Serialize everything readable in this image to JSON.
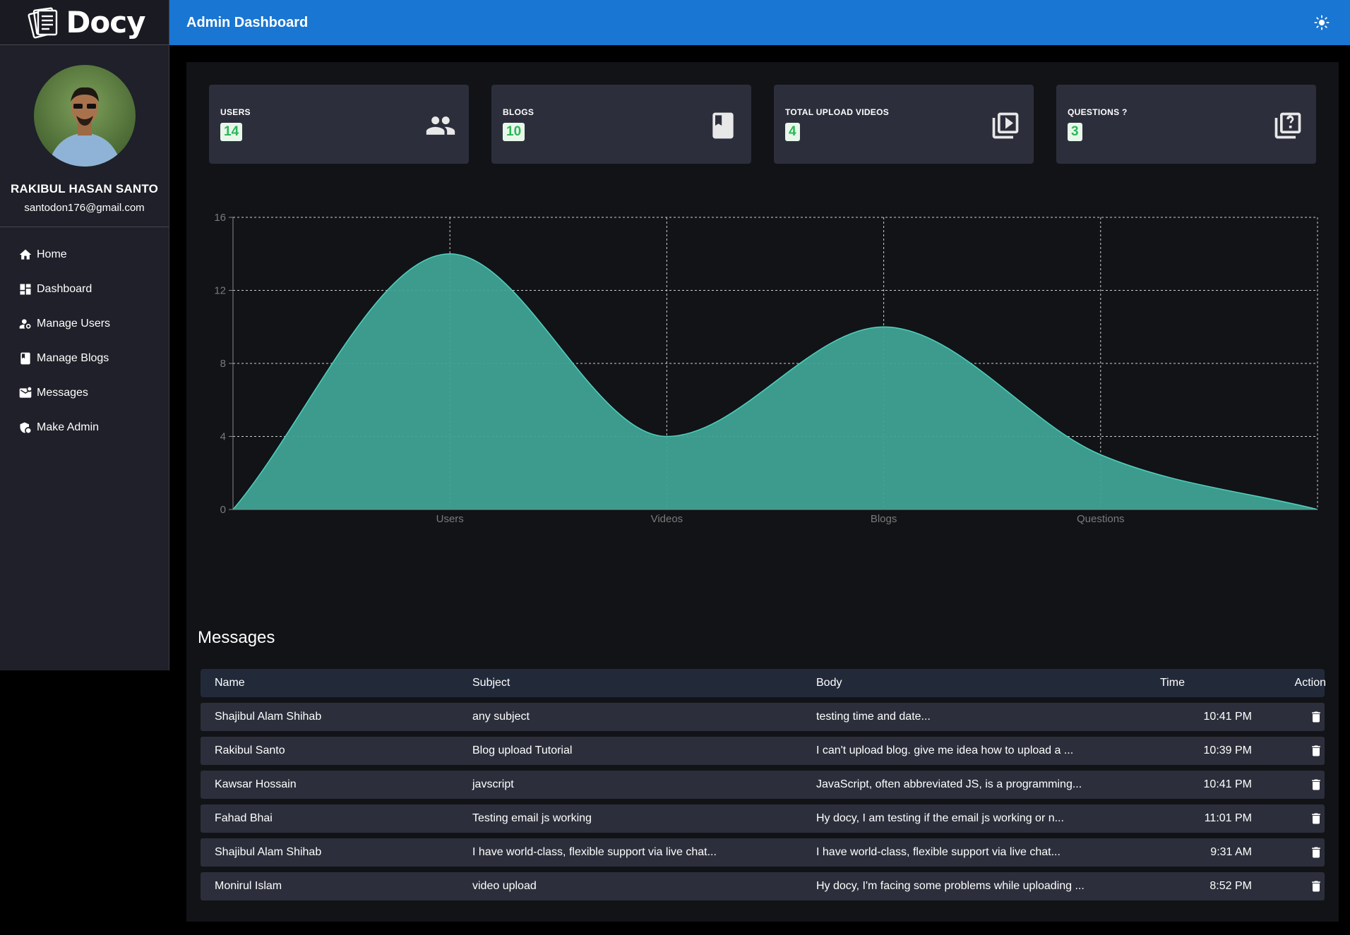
{
  "brand": {
    "name": "Docy"
  },
  "header": {
    "title": "Admin Dashboard"
  },
  "profile": {
    "name": "RAKIBUL HASAN SANTO",
    "email": "santodon176@gmail.com"
  },
  "sidebar": {
    "items": [
      {
        "label": "Home",
        "icon": "home-icon"
      },
      {
        "label": "Dashboard",
        "icon": "dashboard-icon"
      },
      {
        "label": "Manage Users",
        "icon": "manage-users-icon"
      },
      {
        "label": "Manage Blogs",
        "icon": "book-icon"
      },
      {
        "label": "Messages",
        "icon": "mail-icon"
      },
      {
        "label": "Make Admin",
        "icon": "admin-shield-icon"
      }
    ]
  },
  "stats": [
    {
      "label": "USERS",
      "count": "14",
      "icon": "people-icon"
    },
    {
      "label": "BLOGS",
      "count": "10",
      "icon": "book-icon"
    },
    {
      "label": "TOTAL UPLOAD VIDEOS",
      "count": "4",
      "icon": "video-library-icon"
    },
    {
      "label": "QUESTIONS ?",
      "count": "3",
      "icon": "question-library-icon"
    }
  ],
  "chart_data": {
    "type": "area",
    "x": [
      "",
      "Users",
      "Videos",
      "Blogs",
      "Questions",
      ""
    ],
    "values": [
      0,
      14,
      4,
      10,
      3,
      0
    ],
    "yticks": [
      0,
      4,
      8,
      12,
      16
    ],
    "ylim": [
      0,
      16
    ],
    "grid": true,
    "fill_color": "#3fa294",
    "stroke_color": "#4fd1bd"
  },
  "messages": {
    "title": "Messages",
    "columns": [
      "Name",
      "Subject",
      "Body",
      "Time",
      "Action"
    ],
    "rows": [
      {
        "name": "Shajibul Alam Shihab",
        "subject": "any subject",
        "body": "testing time and date...",
        "time": "10:41 PM"
      },
      {
        "name": "Rakibul Santo",
        "subject": "Blog upload Tutorial",
        "body": "I can't upload blog. give me idea how to upload a ...",
        "time": "10:39 PM"
      },
      {
        "name": "Kawsar Hossain",
        "subject": "javscript",
        "body": "JavaScript, often abbreviated JS, is a programming...",
        "time": "10:41 PM"
      },
      {
        "name": "Fahad Bhai",
        "subject": "Testing email js working",
        "body": "Hy docy, I am testing if the email js working or n...",
        "time": "11:01 PM"
      },
      {
        "name": "Shajibul Alam Shihab",
        "subject": "I have world-class, flexible support via live chat...",
        "body": "I have world-class, flexible support via live chat...",
        "time": "9:31 AM"
      },
      {
        "name": "Monirul Islam",
        "subject": "video upload",
        "body": "Hy docy, I'm facing some problems while uploading ...",
        "time": "8:52 PM"
      }
    ]
  }
}
